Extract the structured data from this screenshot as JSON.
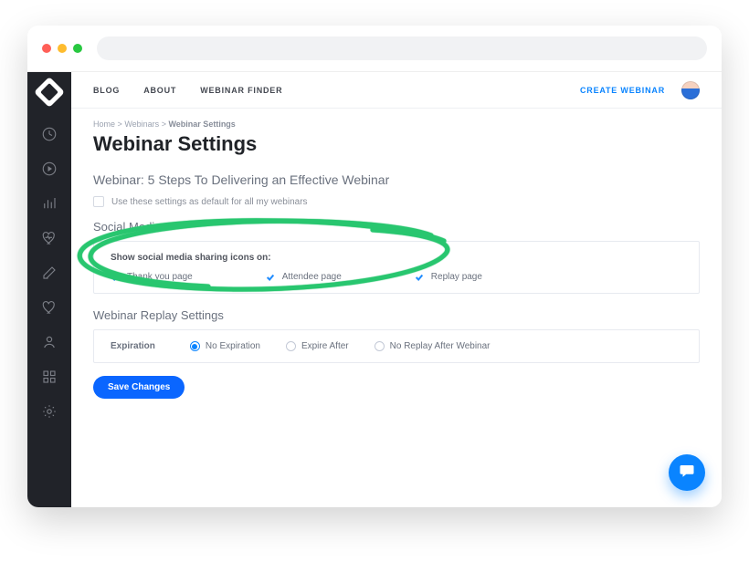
{
  "topnav": {
    "items": [
      "BLOG",
      "ABOUT",
      "WEBINAR FINDER"
    ],
    "create_label": "CREATE WEBINAR"
  },
  "sidebar": {
    "icons": [
      "dashboard-icon",
      "play-icon",
      "chart-icon",
      "heart-rate-icon",
      "edit-icon",
      "heart-icon",
      "user-icon",
      "grid-icon",
      "gear-icon"
    ]
  },
  "breadcrumb": {
    "home": "Home",
    "sep": ">",
    "webinars": "Webinars",
    "current": "Webinar Settings"
  },
  "page": {
    "title": "Webinar Settings",
    "subhead": "Webinar: 5 Steps To Delivering an Effective Webinar",
    "default_checkbox_label": "Use these settings as default for all my webinars"
  },
  "social": {
    "section_label": "Social Media",
    "panel_label": "Show social media sharing icons on:",
    "options": [
      {
        "label": "Thank you page",
        "checked": true
      },
      {
        "label": "Attendee page",
        "checked": true
      },
      {
        "label": "Replay page",
        "checked": true
      }
    ]
  },
  "replay": {
    "section_label": "Webinar Replay Settings",
    "expiration_label": "Expiration",
    "options": [
      {
        "label": "No Expiration",
        "selected": true
      },
      {
        "label": "Expire After",
        "selected": false
      },
      {
        "label": "No Replay After Webinar",
        "selected": false
      }
    ]
  },
  "actions": {
    "save_label": "Save Changes"
  }
}
